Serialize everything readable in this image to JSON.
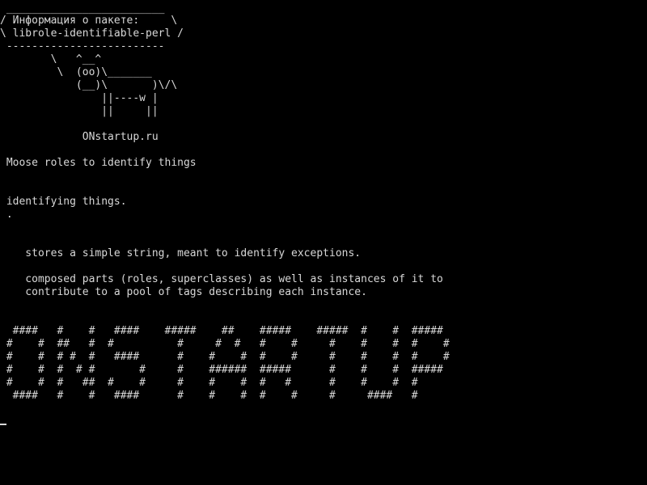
{
  "terminal": {
    "cowsay": {
      "top_border": " _________________________",
      "title_line": "/ Информация о пакете:     \\",
      "package_line": "\\ librole-identifiable-perl /",
      "bottom_border": " -------------------------",
      "cow_1": "        \\   ^__^",
      "cow_2": "         \\  (oo)\\_______",
      "cow_3": "            (__)\\       )\\/\\",
      "cow_4": "                ||----w |",
      "cow_5": "                ||     ||",
      "site": "             ONstartup.ru"
    },
    "summary": " Moose roles to identify things",
    "description_1": " identifying things.",
    "description_2": " .",
    "description_3": "    stores a simple string, meant to identify exceptions.",
    "description_4": "    composed parts (roles, superclasses) as well as instances of it to",
    "description_5": "    contribute to a pool of tags describing each instance.",
    "banner": [
      "  ####   #    #   ####    #####    ##    #####    #####  #    #  #####",
      " #    #  ##   #  #          #     #  #   #    #     #    #    #  #    #",
      " #    #  # #  #   ####      #    #    #  #    #     #    #    #  #    #",
      " #    #  #  # #       #     #    ######  #####      #    #    #  #####",
      " #    #  #   ##  #    #     #    #    #  #   #      #    #    #  #",
      "  ####   #    #   ####      #    #    #  #    #     #     ####   #"
    ]
  }
}
